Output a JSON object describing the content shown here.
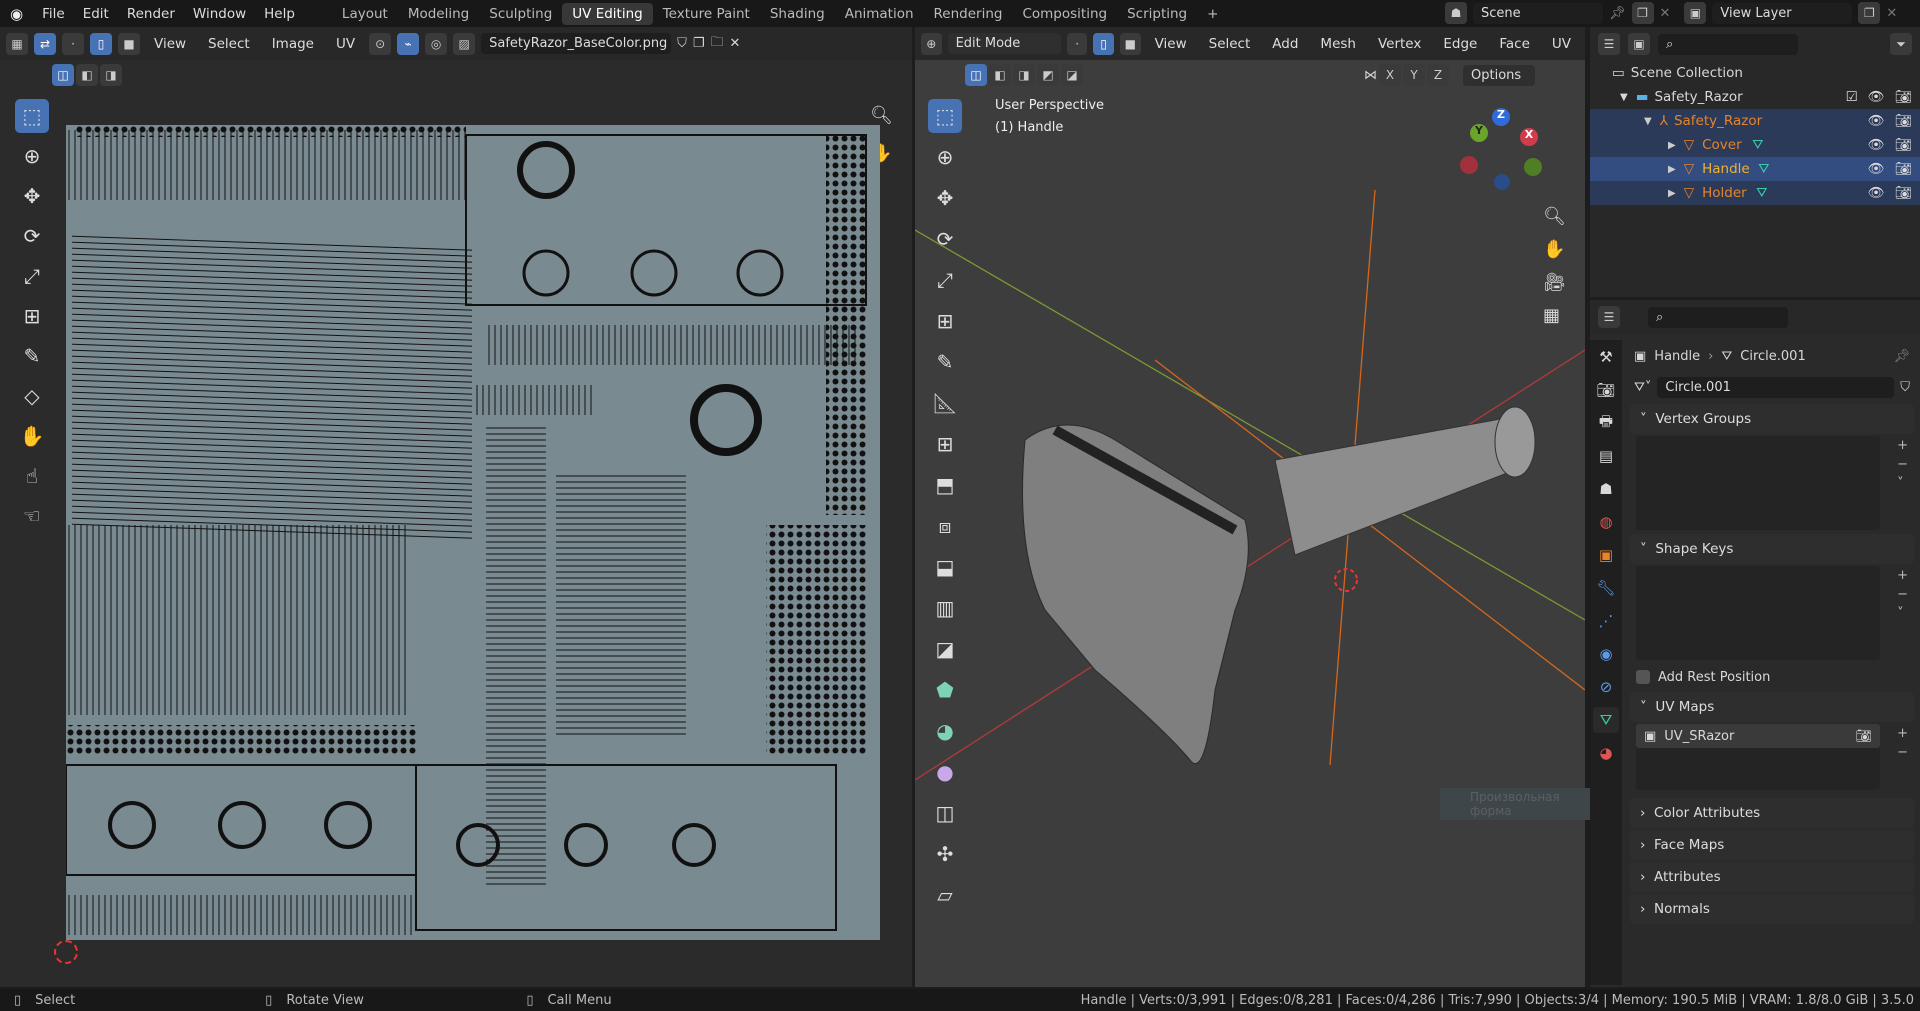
{
  "topbar": {
    "menus": [
      "File",
      "Edit",
      "Render",
      "Window",
      "Help"
    ],
    "workspaces": [
      "Layout",
      "Modeling",
      "Sculpting",
      "UV Editing",
      "Texture Paint",
      "Shading",
      "Animation",
      "Rendering",
      "Compositing",
      "Scripting"
    ],
    "active_workspace": "UV Editing",
    "add_tab": "+",
    "scene": "Scene",
    "view_layer": "View Layer"
  },
  "uv_editor": {
    "menus": [
      "View",
      "Select",
      "Image",
      "UV"
    ],
    "image_name": "SafetyRazor_BaseColor.png"
  },
  "viewport": {
    "mode": "Edit Mode",
    "menus": [
      "View",
      "Select",
      "Add",
      "Mesh",
      "Vertex",
      "Edge",
      "Face",
      "UV"
    ],
    "axes": [
      "X",
      "Y",
      "Z"
    ],
    "options": "Options",
    "overlay_title": "User Perspective",
    "overlay_object": "(1) Handle",
    "gizmo": {
      "x": "X",
      "y": "Y",
      "z": "Z"
    },
    "tooltip": "Произвольная форма"
  },
  "outliner": {
    "items": [
      {
        "label": "Scene Collection",
        "level": 0
      },
      {
        "label": "Safety_Razor",
        "level": 1
      },
      {
        "label": "Safety_Razor",
        "level": 2
      },
      {
        "label": "Cover",
        "level": 3
      },
      {
        "label": "Handle",
        "level": 3
      },
      {
        "label": "Holder",
        "level": 3
      }
    ]
  },
  "properties": {
    "breadcrumb_object": "Handle",
    "breadcrumb_mesh": "Circle.001",
    "mesh_name": "Circle.001",
    "panels": {
      "vertex_groups": "Vertex Groups",
      "shape_keys": "Shape Keys",
      "add_rest_position": "Add Rest Position",
      "uv_maps": "UV Maps",
      "uv_map_item": "UV_SRazor",
      "color_attributes": "Color Attributes",
      "face_maps": "Face Maps",
      "attributes": "Attributes",
      "normals": "Normals"
    }
  },
  "status": {
    "select": "Select",
    "rotate": "Rotate View",
    "menu": "Call Menu",
    "stats": "Handle | Verts:0/3,991 | Edges:0/8,281 | Faces:0/4,286 | Tris:7,990 | Objects:3/4 | Memory: 190.5 MiB | VRAM: 1.8/8.0 GiB | 3.5.0"
  },
  "colors": {
    "accent": "#4772b3",
    "object_orange": "#e8832a",
    "mesh_green": "#3ec7a8",
    "uv_bg": "#7a8a91"
  }
}
